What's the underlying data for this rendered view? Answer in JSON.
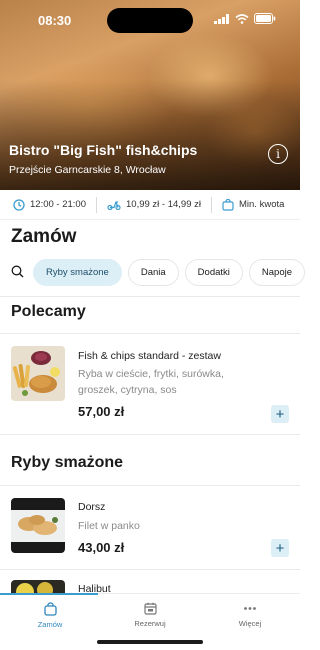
{
  "status_bar": {
    "time": "08:30"
  },
  "restaurant": {
    "name": "Bistro \"Big Fish\" fish&chips",
    "address": "Przejście Garncarskie 8, Wrocław"
  },
  "info": {
    "hours": "12:00 - 21:00",
    "delivery_cost": "10,99 zł - 14,99 zł",
    "min_order": "Min. kwota"
  },
  "order": {
    "title": "Zamów",
    "categories": [
      "Ryby smażone",
      "Dania",
      "Dodatki",
      "Napoje"
    ],
    "active_category": "Ryby smażone"
  },
  "sections": [
    {
      "title": "Polecamy",
      "items": [
        {
          "name": "Fish & chips standard - zestaw",
          "description": "Ryba w cieście, frytki, surówka, groszek, cytryna, sos",
          "price": "57,00 zł"
        }
      ]
    },
    {
      "title": "Ryby smażone",
      "items": [
        {
          "name": "Dorsz",
          "description": "Filet w panko",
          "price": "43,00 zł"
        },
        {
          "name": "Halibut"
        }
      ]
    }
  ],
  "add_label": "+",
  "tabbar": {
    "tabs": [
      {
        "label": "Zamów",
        "icon": "bag-icon",
        "active": true
      },
      {
        "label": "Rezerwuj",
        "icon": "calendar-icon"
      },
      {
        "label": "Więcej",
        "icon": "more-dots-icon"
      }
    ]
  },
  "colors": {
    "accent": "#2e86bd",
    "chip_active_bg": "#dceef6",
    "price_button_bg": "#dceef6"
  }
}
